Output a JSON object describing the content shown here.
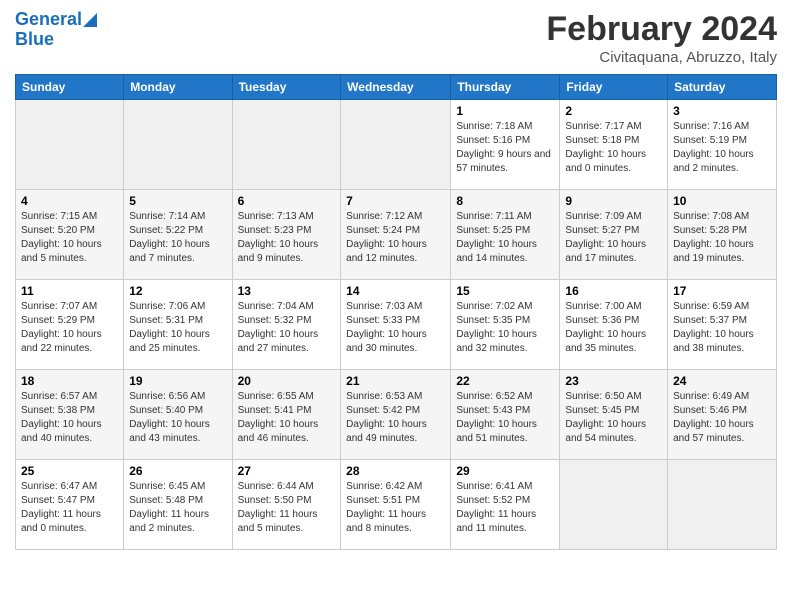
{
  "header": {
    "logo_line1": "General",
    "logo_line2": "Blue",
    "title": "February 2024",
    "subtitle": "Civitaquana, Abruzzo, Italy"
  },
  "weekdays": [
    "Sunday",
    "Monday",
    "Tuesday",
    "Wednesday",
    "Thursday",
    "Friday",
    "Saturday"
  ],
  "weeks": [
    [
      {
        "day": "",
        "empty": true
      },
      {
        "day": "",
        "empty": true
      },
      {
        "day": "",
        "empty": true
      },
      {
        "day": "",
        "empty": true
      },
      {
        "day": "1",
        "sunrise": "7:18 AM",
        "sunset": "5:16 PM",
        "daylight": "9 hours and 57 minutes."
      },
      {
        "day": "2",
        "sunrise": "7:17 AM",
        "sunset": "5:18 PM",
        "daylight": "10 hours and 0 minutes."
      },
      {
        "day": "3",
        "sunrise": "7:16 AM",
        "sunset": "5:19 PM",
        "daylight": "10 hours and 2 minutes."
      }
    ],
    [
      {
        "day": "4",
        "sunrise": "7:15 AM",
        "sunset": "5:20 PM",
        "daylight": "10 hours and 5 minutes."
      },
      {
        "day": "5",
        "sunrise": "7:14 AM",
        "sunset": "5:22 PM",
        "daylight": "10 hours and 7 minutes."
      },
      {
        "day": "6",
        "sunrise": "7:13 AM",
        "sunset": "5:23 PM",
        "daylight": "10 hours and 9 minutes."
      },
      {
        "day": "7",
        "sunrise": "7:12 AM",
        "sunset": "5:24 PM",
        "daylight": "10 hours and 12 minutes."
      },
      {
        "day": "8",
        "sunrise": "7:11 AM",
        "sunset": "5:25 PM",
        "daylight": "10 hours and 14 minutes."
      },
      {
        "day": "9",
        "sunrise": "7:09 AM",
        "sunset": "5:27 PM",
        "daylight": "10 hours and 17 minutes."
      },
      {
        "day": "10",
        "sunrise": "7:08 AM",
        "sunset": "5:28 PM",
        "daylight": "10 hours and 19 minutes."
      }
    ],
    [
      {
        "day": "11",
        "sunrise": "7:07 AM",
        "sunset": "5:29 PM",
        "daylight": "10 hours and 22 minutes."
      },
      {
        "day": "12",
        "sunrise": "7:06 AM",
        "sunset": "5:31 PM",
        "daylight": "10 hours and 25 minutes."
      },
      {
        "day": "13",
        "sunrise": "7:04 AM",
        "sunset": "5:32 PM",
        "daylight": "10 hours and 27 minutes."
      },
      {
        "day": "14",
        "sunrise": "7:03 AM",
        "sunset": "5:33 PM",
        "daylight": "10 hours and 30 minutes."
      },
      {
        "day": "15",
        "sunrise": "7:02 AM",
        "sunset": "5:35 PM",
        "daylight": "10 hours and 32 minutes."
      },
      {
        "day": "16",
        "sunrise": "7:00 AM",
        "sunset": "5:36 PM",
        "daylight": "10 hours and 35 minutes."
      },
      {
        "day": "17",
        "sunrise": "6:59 AM",
        "sunset": "5:37 PM",
        "daylight": "10 hours and 38 minutes."
      }
    ],
    [
      {
        "day": "18",
        "sunrise": "6:57 AM",
        "sunset": "5:38 PM",
        "daylight": "10 hours and 40 minutes."
      },
      {
        "day": "19",
        "sunrise": "6:56 AM",
        "sunset": "5:40 PM",
        "daylight": "10 hours and 43 minutes."
      },
      {
        "day": "20",
        "sunrise": "6:55 AM",
        "sunset": "5:41 PM",
        "daylight": "10 hours and 46 minutes."
      },
      {
        "day": "21",
        "sunrise": "6:53 AM",
        "sunset": "5:42 PM",
        "daylight": "10 hours and 49 minutes."
      },
      {
        "day": "22",
        "sunrise": "6:52 AM",
        "sunset": "5:43 PM",
        "daylight": "10 hours and 51 minutes."
      },
      {
        "day": "23",
        "sunrise": "6:50 AM",
        "sunset": "5:45 PM",
        "daylight": "10 hours and 54 minutes."
      },
      {
        "day": "24",
        "sunrise": "6:49 AM",
        "sunset": "5:46 PM",
        "daylight": "10 hours and 57 minutes."
      }
    ],
    [
      {
        "day": "25",
        "sunrise": "6:47 AM",
        "sunset": "5:47 PM",
        "daylight": "11 hours and 0 minutes."
      },
      {
        "day": "26",
        "sunrise": "6:45 AM",
        "sunset": "5:48 PM",
        "daylight": "11 hours and 2 minutes."
      },
      {
        "day": "27",
        "sunrise": "6:44 AM",
        "sunset": "5:50 PM",
        "daylight": "11 hours and 5 minutes."
      },
      {
        "day": "28",
        "sunrise": "6:42 AM",
        "sunset": "5:51 PM",
        "daylight": "11 hours and 8 minutes."
      },
      {
        "day": "29",
        "sunrise": "6:41 AM",
        "sunset": "5:52 PM",
        "daylight": "11 hours and 11 minutes."
      },
      {
        "day": "",
        "empty": true
      },
      {
        "day": "",
        "empty": true
      }
    ]
  ]
}
